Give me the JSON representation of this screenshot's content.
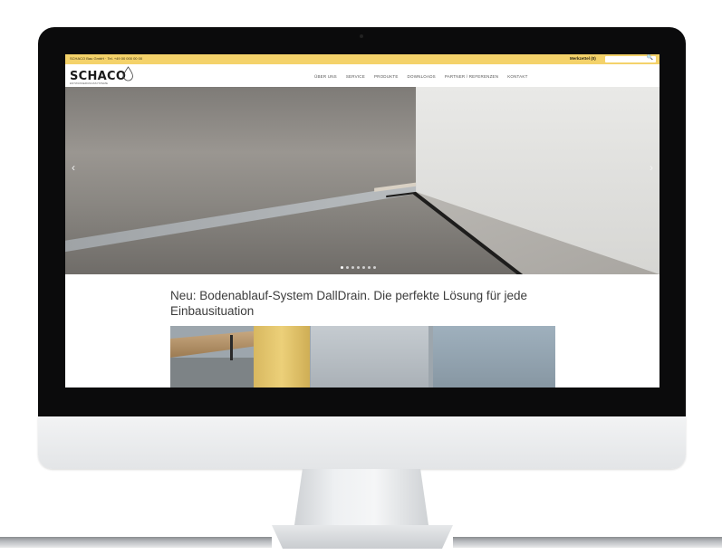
{
  "topbar": {
    "contact_text": "SCHACO Bau GmbH · Tel. +49 00 000 00 00",
    "merkzettel_label": "Merkzettel (0)",
    "search_placeholder": ""
  },
  "header": {
    "logo_text": "SCHACO",
    "logo_tagline": "ENTWÄSSERUNGSSYSTEME",
    "nav_items": [
      "ÜBER UNS",
      "SERVICE",
      "PRODUKTE",
      "DOWNLOADS",
      "PARTNER / REFERENZEN",
      "KONTAKT"
    ]
  },
  "hero": {
    "prev_icon": "‹",
    "next_icon": "›",
    "slide_count": 7,
    "active_slide": 1
  },
  "article": {
    "headline": "Neu: Bodenablauf-System DallDrain. Die perfekte Lösung für jede Einbausituation"
  },
  "colors": {
    "topbar": "#f4d26a",
    "bezel": "#0b0b0c",
    "headline_text": "#3c3c3c"
  },
  "icons": [
    "drop-icon",
    "search-icon",
    "chevron-left-icon",
    "chevron-right-icon"
  ]
}
